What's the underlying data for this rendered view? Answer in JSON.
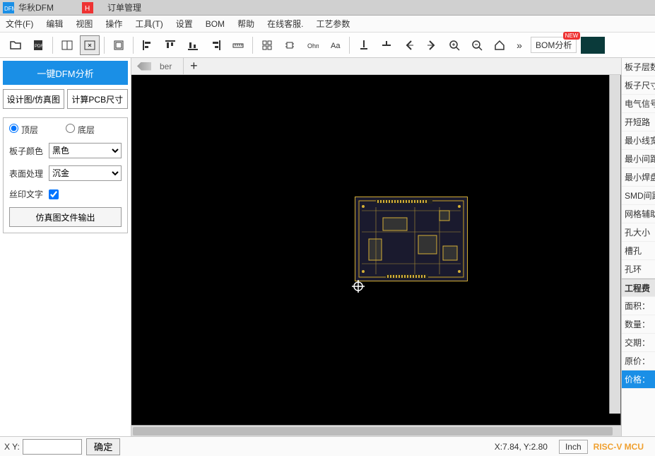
{
  "titlebar": {
    "app_name": "华秋DFM",
    "second_tab": "订单管理"
  },
  "menubar": [
    "文件(F)",
    "编辑",
    "视图",
    "操作",
    "工具(T)",
    "设置",
    "BOM",
    "帮助",
    "在线客服.",
    "工艺参数"
  ],
  "toolbar_icons": [
    "open-folder-icon",
    "export-pdf-icon",
    "",
    "panel-split-icon",
    "panel-select-icon",
    "",
    "layers-icon",
    "",
    "align-left-icon",
    "align-top-icon",
    "align-bottom-icon",
    "align-right-icon",
    "ruler-icon",
    "",
    "grid-icon",
    "chip-icon",
    "resistor-icon",
    "text-icon",
    "",
    "pin-icon",
    "plane-icon",
    "arrow-left-icon",
    "arrow-right-icon",
    "zoom-in-icon",
    "zoom-out-icon",
    "home-icon"
  ],
  "bom_label": "BOM分析",
  "bom_badge": "NEW",
  "left": {
    "primary_btn": "一键DFM分析",
    "btn_design": "设计图/仿真图",
    "btn_calc": "计算PCB尺寸",
    "radio_top": "顶层",
    "radio_bottom": "底层",
    "label_color": "板子颜色",
    "color_value": "黑色",
    "label_surface": "表面处理",
    "surface_value": "沉金",
    "label_silk": "丝印文字",
    "silk_checked": true,
    "btn_output": "仿真图文件输出"
  },
  "tab": {
    "name": "ber"
  },
  "right_items": [
    "板子层数",
    "板子尺寸",
    "电气信号",
    "开短路",
    "最小线宽",
    "最小间距",
    "最小焊盘",
    "SMD间距",
    "网格辅助",
    "孔大小",
    "槽孔",
    "孔环"
  ],
  "right_section": "工程费",
  "cost_items": [
    "面积：",
    "数量：",
    "交期：",
    "原价：",
    "价格："
  ],
  "status": {
    "xy_label": "X Y:",
    "ok": "确定",
    "coords": "X:7.84, Y:2.80",
    "unit": "Inch",
    "watermark": "RISC-V MCU"
  }
}
